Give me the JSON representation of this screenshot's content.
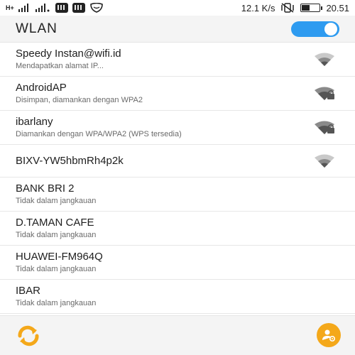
{
  "status_bar": {
    "left_text_1": "H+",
    "right_text": "12.1 K/s",
    "time": "20.51"
  },
  "header": {
    "title": "WLAN",
    "wifi_enabled": true
  },
  "colors": {
    "accent": "#2e9bf0",
    "fab": "#f4a81a",
    "refresh": "#f4a81a"
  },
  "networks": [
    {
      "ssid": "Speedy Instan@wifi.id",
      "status": "Mendapatkan alamat IP...",
      "icon": "wifi-signal-icon",
      "secured": false
    },
    {
      "ssid": "AndroidAP",
      "status": "Disimpan, diamankan dengan WPA2",
      "icon": "wifi-locked-icon",
      "secured": true
    },
    {
      "ssid": "ibarlany",
      "status": "Diamankan dengan WPA/WPA2 (WPS tersedia)",
      "icon": "wifi-locked-icon",
      "secured": true
    },
    {
      "ssid": "BIXV-YW5hbmRh4p2k",
      "status": "",
      "icon": "wifi-signal-icon",
      "secured": false
    },
    {
      "ssid": "BANK BRI 2",
      "status": "Tidak dalam jangkauan",
      "icon": "",
      "secured": false
    },
    {
      "ssid": "D.TAMAN CAFE",
      "status": "Tidak dalam jangkauan",
      "icon": "",
      "secured": false
    },
    {
      "ssid": "HUAWEI-FM964Q",
      "status": "Tidak dalam jangkauan",
      "icon": "",
      "secured": false
    },
    {
      "ssid": "IBAR",
      "status": "Tidak dalam jangkauan",
      "icon": "",
      "secured": false
    }
  ],
  "bottom_bar": {
    "left_icon": "refresh-icon",
    "right_icon": "add-network-icon"
  }
}
